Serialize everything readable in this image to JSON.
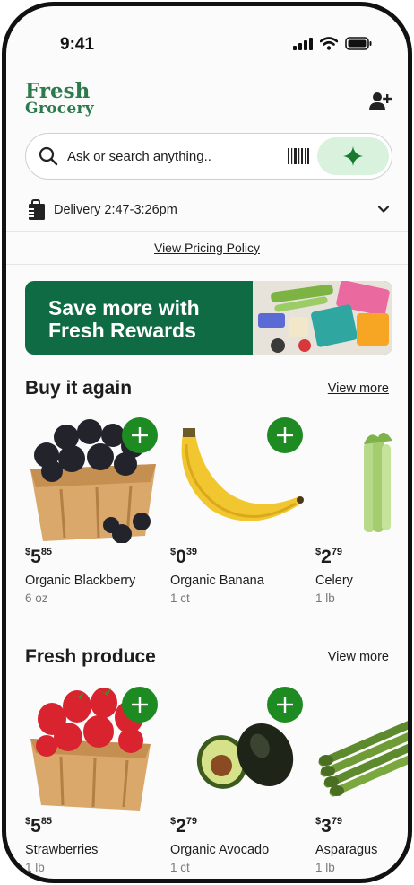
{
  "status_bar": {
    "time": "9:41"
  },
  "header": {
    "logo_line1": "Fresh",
    "logo_line2": "Grocery"
  },
  "search": {
    "placeholder": "Ask or search anything.."
  },
  "delivery": {
    "label": "Delivery 2:47-3:26pm"
  },
  "pricing_link": "View Pricing Policy",
  "banner": {
    "line1": "Save more with",
    "line2": "Fresh Rewards"
  },
  "sections": [
    {
      "title": "Buy it again",
      "view_more": "View more",
      "items": [
        {
          "name": "Organic Blackberry",
          "dollars": "5",
          "cents": "85",
          "currency": "$",
          "qty": "6 oz",
          "image": "blackberries-image"
        },
        {
          "name": "Organic Banana",
          "dollars": "0",
          "cents": "39",
          "currency": "$",
          "qty": "1 ct",
          "image": "banana-image"
        },
        {
          "name": "Celery",
          "dollars": "2",
          "cents": "79",
          "currency": "$",
          "qty": "1 lb",
          "image": "celery-image"
        }
      ]
    },
    {
      "title": "Fresh produce",
      "view_more": "View more",
      "items": [
        {
          "name": "Strawberries",
          "dollars": "5",
          "cents": "85",
          "currency": "$",
          "qty": "1 lb",
          "image": "strawberries-image"
        },
        {
          "name": "Organic Avocado",
          "dollars": "2",
          "cents": "79",
          "currency": "$",
          "qty": "1 ct",
          "image": "avocado-image"
        },
        {
          "name": "Asparagus",
          "dollars": "3",
          "cents": "79",
          "currency": "$",
          "qty": "1 lb",
          "image": "asparagus-image"
        }
      ]
    }
  ],
  "colors": {
    "brand_green": "#2d7a4c",
    "add_button": "#1d8a22",
    "banner_bg": "#0f6b44",
    "sparkle_bg": "#d8f2de"
  },
  "icons": [
    "signal-icon",
    "wifi-icon",
    "battery-icon",
    "add-user-icon",
    "search-icon",
    "barcode-icon",
    "sparkle-icon",
    "delivery-bag-icon",
    "chevron-down-icon",
    "plus-icon"
  ]
}
